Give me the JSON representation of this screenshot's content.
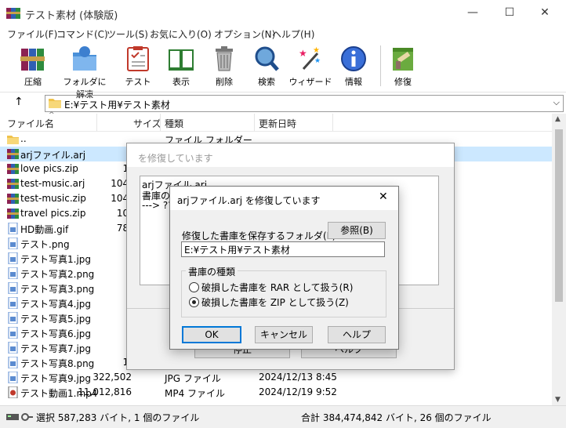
{
  "window": {
    "title": "テスト素材 (体験版)",
    "min": "—",
    "max": "☐",
    "close": "✕"
  },
  "menu": [
    "ファイル(F)",
    "コマンド(C)",
    "ツール(S)",
    "お気に入り(O)",
    "オプション(N)",
    "ヘルプ(H)"
  ],
  "toolbar": [
    {
      "label": "圧縮",
      "icon": "archive-books-icon"
    },
    {
      "label": "フォルダに解凍",
      "icon": "extract-folder-icon"
    },
    {
      "label": "テスト",
      "icon": "test-clipboard-icon"
    },
    {
      "label": "表示",
      "icon": "view-book-icon"
    },
    {
      "label": "削除",
      "icon": "trash-icon"
    },
    {
      "label": "検索",
      "icon": "magnifier-icon"
    },
    {
      "label": "ウィザード",
      "icon": "wizard-wand-icon"
    },
    {
      "label": "情報",
      "icon": "info-icon"
    },
    {
      "label": "修復",
      "icon": "repair-icon"
    }
  ],
  "address": {
    "path": "E:¥テスト用¥テスト素材",
    "up_icon": "↑"
  },
  "columns": {
    "name": "ファイル名",
    "size": "サイズ",
    "type": "種類",
    "date": "更新日時"
  },
  "files": [
    {
      "name": "..",
      "size": "",
      "type": "ファイル フォルダー",
      "date": "",
      "icon": "folder"
    },
    {
      "name": "arjファイル.arj",
      "size": "",
      "type": "",
      "date": "",
      "icon": "rar"
    },
    {
      "name": "love pics.zip",
      "size": "1,",
      "type": "",
      "date": "",
      "icon": "rar"
    },
    {
      "name": "test-music.arj",
      "size": "104,",
      "type": "",
      "date": "",
      "icon": "rar"
    },
    {
      "name": "test-music.zip",
      "size": "104,",
      "type": "",
      "date": "",
      "icon": "rar"
    },
    {
      "name": "travel pics.zip",
      "size": "10,",
      "type": "",
      "date": "",
      "icon": "rar"
    },
    {
      "name": "HD動画.gif",
      "size": "78,",
      "type": "",
      "date": "",
      "icon": "img"
    },
    {
      "name": "テスト.png",
      "size": "",
      "type": "",
      "date": "",
      "icon": "img"
    },
    {
      "name": "テスト写真1.jpg",
      "size": "",
      "type": "",
      "date": "",
      "icon": "img"
    },
    {
      "name": "テスト写真2.png",
      "size": "",
      "type": "",
      "date": "",
      "icon": "img"
    },
    {
      "name": "テスト写真3.png",
      "size": "",
      "type": "",
      "date": "",
      "icon": "img"
    },
    {
      "name": "テスト写真4.jpg",
      "size": "",
      "type": "",
      "date": "",
      "icon": "img"
    },
    {
      "name": "テスト写真5.jpg",
      "size": "",
      "type": "",
      "date": "",
      "icon": "img"
    },
    {
      "name": "テスト写真6.jpg",
      "size": "",
      "type": "",
      "date": "",
      "icon": "img"
    },
    {
      "name": "テスト写真7.jpg",
      "size": "",
      "type": "",
      "date": "",
      "icon": "img"
    },
    {
      "name": "テスト写真8.png",
      "size": "1,",
      "type": "",
      "date": "",
      "icon": "img"
    },
    {
      "name": "テスト写真9.jpg",
      "size": "322,502",
      "type": "JPG ファイル",
      "date": "2024/12/13 8:45",
      "icon": "img"
    },
    {
      "name": "テスト動画1.mp4",
      "size": "11,012,816",
      "type": "MP4 ファイル",
      "date": "2024/12/19 9:52",
      "icon": "video"
    }
  ],
  "status": {
    "left": "選択 587,283 バイト, 1 個のファイル",
    "right": "合計 384,474,842 バイト, 26 個のファイル"
  },
  "progress_dialog": {
    "title": "を修復しています",
    "log_lines": [
      "arjファイル.arj",
      "書庫の",
      "---> ???"
    ],
    "stop_button": "停止",
    "help_button": "ヘルプ"
  },
  "modal": {
    "title": "arjファイル.arj を修復しています",
    "folder_label": "修復した書庫を保存するフォルダ(F)",
    "browse_button": "参照(B)",
    "folder_value": "E:¥テスト用¥テスト素材",
    "group_title": "書庫の種類",
    "radio_rar": "破損した書庫を RAR として扱う(R)",
    "radio_zip": "破損した書庫を ZIP として扱う(Z)",
    "selected": "zip",
    "ok": "OK",
    "cancel": "キャンセル",
    "help": "ヘルプ"
  }
}
